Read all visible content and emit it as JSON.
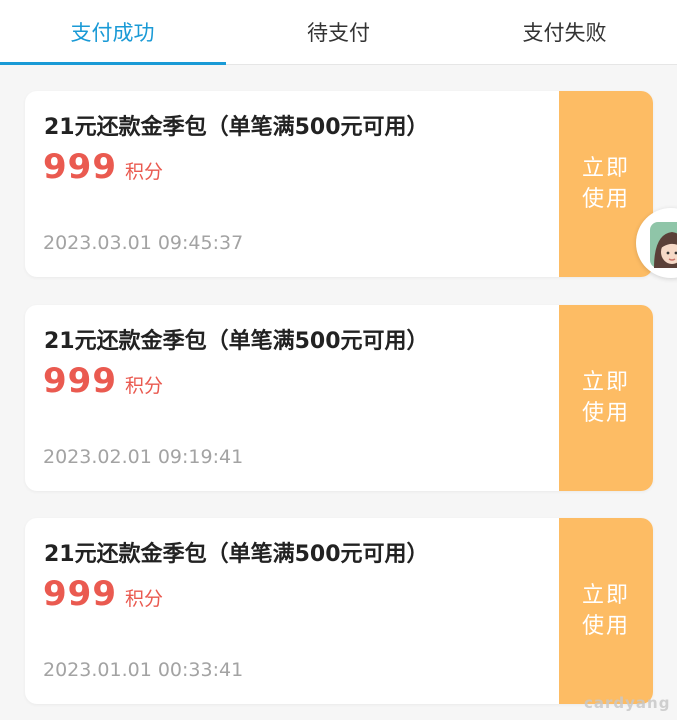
{
  "colors": {
    "accent": "#1a9ad6",
    "points": "#ea5a50",
    "use_button": "#fdbc64"
  },
  "tabs": [
    {
      "label": "支付成功",
      "active": true
    },
    {
      "label": "待支付",
      "active": false
    },
    {
      "label": "支付失败",
      "active": false
    }
  ],
  "orders": [
    {
      "title": "21元还款金季包（单笔满500元可用）",
      "points": "999",
      "points_unit": "积分",
      "time": "2023.03.01 09:45:37",
      "action_label": "立即使用"
    },
    {
      "title": "21元还款金季包（单笔满500元可用）",
      "points": "999",
      "points_unit": "积分",
      "time": "2023.02.01 09:19:41",
      "action_label": "立即使用"
    },
    {
      "title": "21元还款金季包（单笔满500元可用）",
      "points": "999",
      "points_unit": "积分",
      "time": "2023.01.01 00:33:41",
      "action_label": "立即使用"
    }
  ],
  "floating_avatar": {
    "icon": "assistant-avatar-icon"
  },
  "watermark": "cardyang"
}
